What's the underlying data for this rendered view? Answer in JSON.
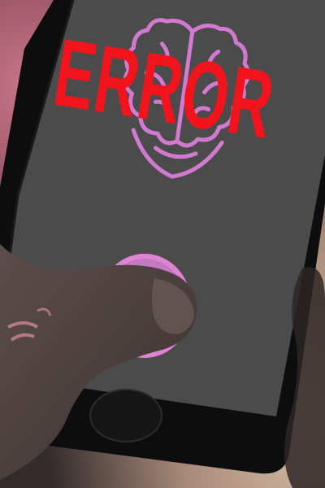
{
  "screen": {
    "error_text": "ERROR",
    "error_color": "#f2141c",
    "screen_color": "#4b4b4b",
    "icon": "brain-icon",
    "icon_color": "#d27ad0",
    "button_color": "#c98ec8"
  },
  "device": {
    "body_color": "#0d0d0e",
    "home_button": "home-button"
  }
}
